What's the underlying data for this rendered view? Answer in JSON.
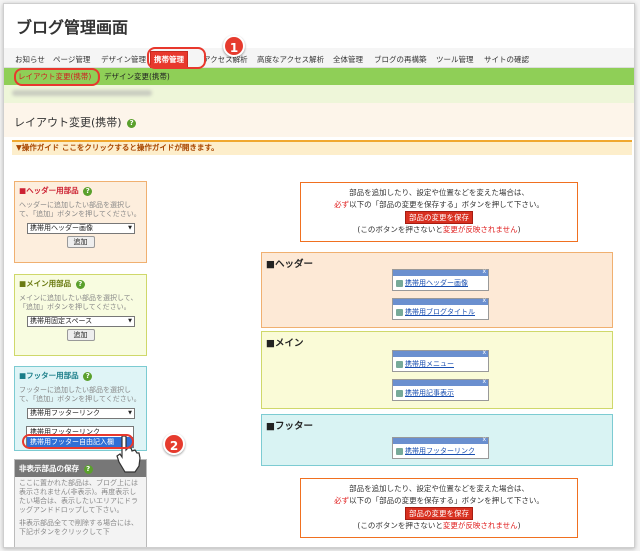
{
  "app": {
    "title": "ブログ管理画面"
  },
  "nav": {
    "tabs": [
      {
        "label": "お知らせ"
      },
      {
        "label": "ページ管理"
      },
      {
        "label": "デザイン管理"
      },
      {
        "label": "携帯管理"
      },
      {
        "label": "アクセス解析"
      },
      {
        "label": "高度なアクセス解析"
      },
      {
        "label": "全体管理"
      },
      {
        "label": "ブログの再構築"
      },
      {
        "label": "ツール管理"
      },
      {
        "label": "サイトの確認"
      }
    ]
  },
  "subnav": {
    "items": [
      {
        "label": "レイアウト変更(携帯)"
      },
      {
        "label": "デザイン変更(携帯)"
      }
    ],
    "sep": "|"
  },
  "page": {
    "title": "レイアウト変更(携帯)",
    "help_icon": "?"
  },
  "guide": {
    "text": "▼操作ガイド ここをクリックすると操作ガイドが開きます。"
  },
  "panels": {
    "header": {
      "title": "■ヘッダー用部品",
      "desc": "ヘッダーに追加したい部品を選択して、「追加」ボタンを押してください。",
      "select": "携帯用ヘッダー画像",
      "button": "追加"
    },
    "main": {
      "title": "■メイン用部品",
      "desc": "メインに追加したい部品を選択して、「追加」ボタンを押してください。",
      "select": "携帯用固定スペース",
      "button": "追加"
    },
    "footer": {
      "title": "■フッター用部品",
      "desc": "フッターに追加したい部品を選択して、「追加」ボタンを押してください。",
      "select": "携帯用フッターリンク"
    },
    "hidden": {
      "title": "非表示部品の保存",
      "desc": "ここに置かれた部品は、ブログ上には表示されません(非表示)。再度表示したい場合は、表示したいエリアにドラッグアンドドロップして下さい。",
      "desc2": "非表示部品全てで削除する場合には、下記ボタンをクリックして下"
    }
  },
  "dropdown": {
    "options": [
      "携帯用フッターリンク",
      "携帯用フッター自由記入欄"
    ]
  },
  "notice": {
    "line1": "部品を追加したり、設定や位置などを変えた場合は、",
    "line2_red": "必ず",
    "line2": "以下の「部品の変更を保存する」ボタンを押して下さい。",
    "button": "部品の変更を保存",
    "line3_pre": "(このボタンを押さないと",
    "line3_red": "変更が反映されません",
    "line3_post": ")"
  },
  "zones": {
    "header": {
      "title": "■ヘッダー",
      "parts": [
        "携帯用ヘッダー画像",
        "携帯用ブログタイトル"
      ]
    },
    "main": {
      "title": "■メイン",
      "parts": [
        "携帯用メニュー",
        "携帯用記事表示"
      ]
    },
    "footer": {
      "title": "■フッター",
      "parts": [
        "携帯用フッターリンク"
      ]
    }
  },
  "annotations": {
    "badge1": "1",
    "badge2": "2"
  },
  "colors": {
    "accent_red": "#e8382d",
    "green_bar": "#8fcf57",
    "guide_bg": "#fdeecb"
  }
}
